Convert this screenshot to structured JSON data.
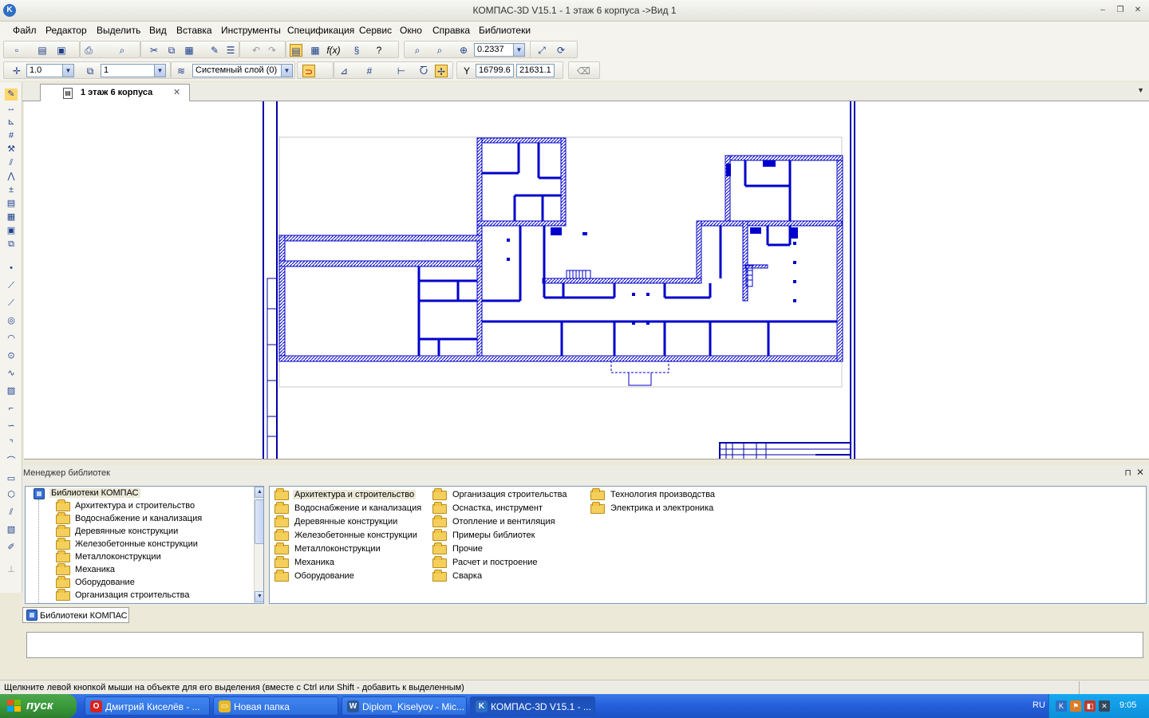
{
  "window": {
    "title": "КОМПАС-3D V15.1 - 1 этаж 6 корпуса ->Вид 1",
    "app_icon_letter": "K",
    "minimize": "–",
    "restore": "❐",
    "close": "✕"
  },
  "menu": [
    "Файл",
    "Редактор",
    "Выделить",
    "Вид",
    "Вставка",
    "Инструменты",
    "Спецификация",
    "Сервис",
    "Окно",
    "Справка",
    "Библиотеки"
  ],
  "toolbar": {
    "zoom_value": "0.2337",
    "line_scale": "1.0",
    "view_number": "1",
    "layer": "Системный слой (0)",
    "coord_x": "16799.6",
    "coord_y": "21631.1",
    "fx_label": "f(x)"
  },
  "document": {
    "tab_label": "1 этаж 6 корпуса",
    "tab_close": "✕"
  },
  "library_manager": {
    "title": "Менеджер библиотек",
    "pin": "⊓",
    "close": "✕",
    "root": "Библиотеки КОМПАС",
    "tree_items": [
      "Архитектура и строительство",
      "Водоснабжение и канализация",
      "Деревянные конструкции",
      "Железобетонные конструкции",
      "Металлоконструкции",
      "Механика",
      "Оборудование",
      "Организация строительства"
    ],
    "grid_columns": [
      [
        "Архитектура и строительство",
        "Водоснабжение и канализация",
        "Деревянные конструкции",
        "Железобетонные конструкции",
        "Металлоконструкции",
        "Механика",
        "Оборудование"
      ],
      [
        "Организация строительства",
        "Оснастка, инструмент",
        "Отопление и вентиляция",
        "Примеры библиотек",
        "Прочие",
        "Расчет и построение",
        "Сварка"
      ],
      [
        "Технология производства",
        "Электрика и электроника"
      ]
    ],
    "tab_label": "Библиотеки КОМПАС"
  },
  "status": {
    "hint": "Щелкните левой кнопкой мыши на объекте для его выделения (вместе с Ctrl или Shift - добавить к выделенным)"
  },
  "taskbar": {
    "start": "пуск",
    "tasks": [
      {
        "label": "Дмитрий Киселёв - ...",
        "icon": "O",
        "color": "#d8221f"
      },
      {
        "label": "Новая папка",
        "icon": "▭",
        "color": "#e8b923"
      },
      {
        "label": "Diplom_Kiselyov - Mic...",
        "icon": "W",
        "color": "#2b5797"
      },
      {
        "label": "КОМПАС-3D V15.1 - ...",
        "icon": "K",
        "color": "#2d6fc4"
      }
    ],
    "lang": "RU",
    "clock": "9:05"
  },
  "colors": {
    "drawing_walls": "#0000cc",
    "frame": "#0000aa"
  }
}
